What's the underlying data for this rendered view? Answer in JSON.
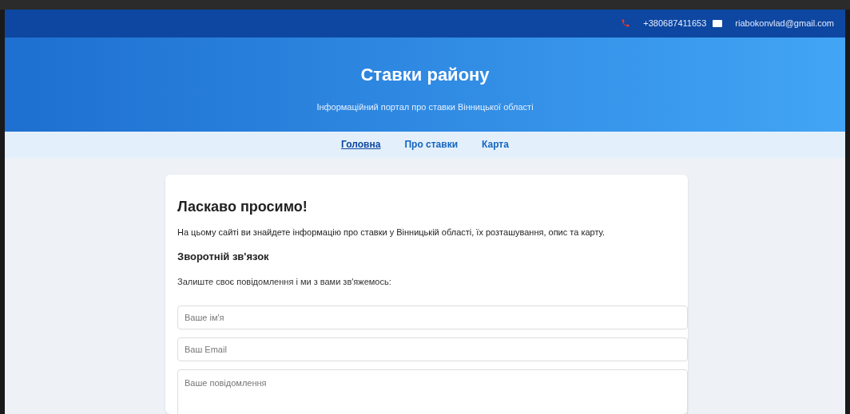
{
  "contact_bar": {
    "phone": "+380687411653",
    "email": "riabokonvlad@gmail.com"
  },
  "header": {
    "title": "Ставки району",
    "subtitle": "Інформаційний портал про ставки Вінницької області"
  },
  "nav": [
    {
      "label": "Головна",
      "selected": true
    },
    {
      "label": "Про ставки",
      "selected": false
    },
    {
      "label": "Карта",
      "selected": false
    }
  ],
  "welcome": {
    "heading": "Ласкаво просимо!",
    "text": "На цьому сайті ви знайдете інформацію про ставки у Вінницькій області, їх розташування, опис та карту."
  },
  "feedback": {
    "heading": "Зворотній зв'язок",
    "text": "Залиште своє повідомлення і ми з вами зв'яжемось:",
    "fields": [
      {
        "kind": "input",
        "placeholder": "Ваше ім'я"
      },
      {
        "kind": "input",
        "placeholder": "Ваш Email"
      },
      {
        "kind": "textarea",
        "placeholder": "Ваше повідомлення"
      }
    ]
  }
}
